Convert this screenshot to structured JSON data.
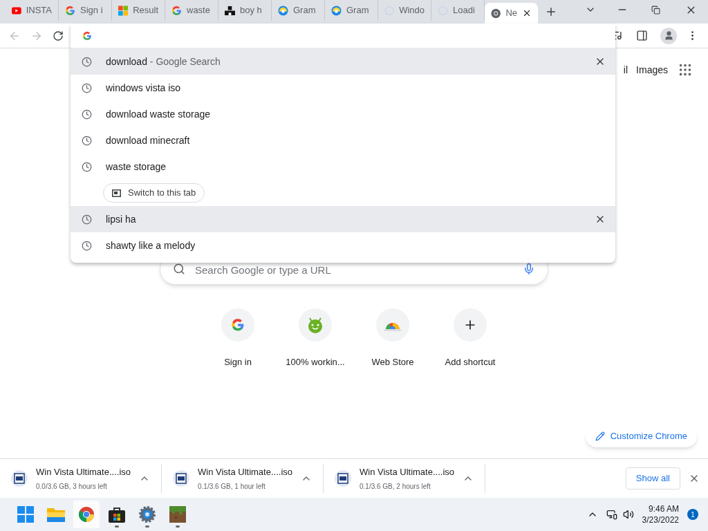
{
  "tabs": [
    {
      "title": "INSTA",
      "kind": "youtube",
      "selected": false
    },
    {
      "title": "Sign i",
      "kind": "google",
      "selected": false
    },
    {
      "title": "Result",
      "kind": "windows",
      "selected": false
    },
    {
      "title": "waste",
      "kind": "google",
      "selected": false
    },
    {
      "title": "boy h",
      "kind": "dark",
      "selected": false
    },
    {
      "title": "Gram",
      "kind": "edge",
      "selected": false
    },
    {
      "title": "Gram",
      "kind": "edge",
      "selected": false
    },
    {
      "title": "Windo",
      "kind": "loading",
      "selected": false
    },
    {
      "title": "Loadi",
      "kind": "loading",
      "selected": false
    },
    {
      "title": "Ne",
      "kind": "chrome",
      "selected": true
    }
  ],
  "omnibox": {
    "suggestions": [
      {
        "text": "download",
        "suffix": " - Google Search",
        "selected": true
      },
      {
        "text": "windows vista iso",
        "selected": false
      },
      {
        "text": "download waste storage",
        "selected": false
      },
      {
        "text": "download minecraft",
        "selected": false
      },
      {
        "text": "waste storage",
        "selected": false,
        "action": "Switch to this tab"
      },
      {
        "text": "lipsi ha",
        "selected": true
      },
      {
        "text": "shawty like a melody",
        "selected": false
      }
    ]
  },
  "header_links": [
    "il",
    "Images"
  ],
  "search": {
    "placeholder": "Search Google or type a URL"
  },
  "shortcuts": [
    {
      "label": "Sign in",
      "kind": "google"
    },
    {
      "label": "100% workin...",
      "kind": "android"
    },
    {
      "label": "Web Store",
      "kind": "store"
    },
    {
      "label": "Add shortcut",
      "kind": "plus"
    }
  ],
  "customize_button": "Customize Chrome",
  "downloads": [
    {
      "name": "Win Vista Ultimate....iso",
      "status": "0.0/3.6 GB, 3 hours left"
    },
    {
      "name": "Win Vista Ultimate....iso",
      "status": "0.1/3.6 GB, 1 hour left"
    },
    {
      "name": "Win Vista Ultimate....iso",
      "status": "0.1/3.6 GB, 2 hours left"
    }
  ],
  "show_all": "Show all",
  "taskbar": {
    "apps": [
      {
        "kind": "start",
        "active": false,
        "running": false
      },
      {
        "kind": "folder",
        "active": false,
        "running": false
      },
      {
        "kind": "chrome",
        "active": true,
        "running": false
      },
      {
        "kind": "store",
        "active": false,
        "running": true
      },
      {
        "kind": "settings",
        "active": false,
        "running": true
      },
      {
        "kind": "minecraft",
        "active": false,
        "running": true
      }
    ],
    "time": "9:46 AM",
    "date": "3/23/2022",
    "notifications": "1"
  }
}
